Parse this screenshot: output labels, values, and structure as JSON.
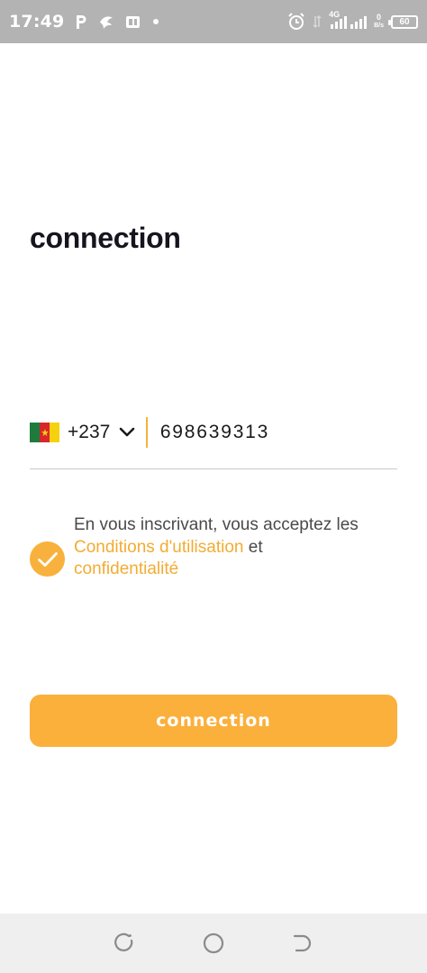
{
  "status_bar": {
    "time": "17:49",
    "network": "4G",
    "speed_top": "0",
    "speed_unit": "B/s",
    "battery": "60",
    "icons": [
      "parking-icon",
      "bird-icon",
      "sim-icon",
      "dot-icon",
      "alarm-icon",
      "signal-icon",
      "battery-icon"
    ]
  },
  "page": {
    "title": "connection"
  },
  "phone": {
    "country_flag": "cameroon-flag",
    "country_code": "+237",
    "number": "698639313"
  },
  "terms": {
    "checked": true,
    "text_before": "En vous inscrivant, vous acceptez les",
    "link_conditions": "Conditions d'utilisation",
    "connector": "et",
    "link_privacy": "confidentialité"
  },
  "actions": {
    "submit_label": "connection"
  },
  "colors": {
    "accent": "#fbb03b",
    "link": "#f2ac33",
    "status_bar": "#b3b3b3",
    "nav_bar": "#efefef",
    "title": "#15151f"
  }
}
